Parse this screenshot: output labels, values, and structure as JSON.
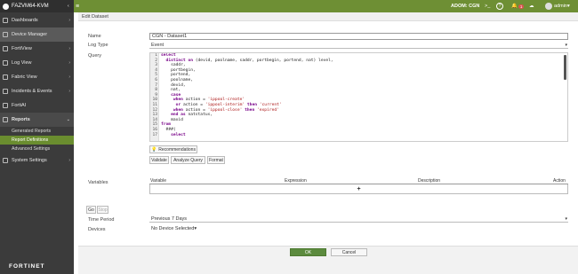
{
  "topbar": {
    "app_name": "FAZVM64-KVM",
    "adom_label": "ADOM: CGN",
    "notification_count": "1",
    "user_name": "admin"
  },
  "sidebar": {
    "items": [
      {
        "label": "Dashboards"
      },
      {
        "label": "Device Manager"
      },
      {
        "label": "FortiView"
      },
      {
        "label": "Log View"
      },
      {
        "label": "Fabric View"
      },
      {
        "label": "Incidents & Events"
      },
      {
        "label": "FortiAI"
      },
      {
        "label": "Reports"
      }
    ],
    "subitems": [
      {
        "label": "Generated Reports"
      },
      {
        "label": "Report Definitions"
      },
      {
        "label": "Advanced Settings"
      }
    ],
    "system_settings": "System Settings",
    "footer": "FORTINET"
  },
  "dialog": {
    "title": "Edit Dataset",
    "name_label": "Name",
    "name_value": "CGN - Dataset1",
    "log_type_label": "Log Type",
    "log_type_value": "Event",
    "query_label": "Query",
    "line_numbers": [
      "1",
      "2",
      "3",
      "4",
      "5",
      "6",
      "7",
      "8",
      "9",
      "10",
      "11",
      "12",
      "13",
      "14",
      "15",
      "16",
      "17"
    ],
    "recommendations_label": "Recommendations",
    "validate_label": "Validate",
    "analyze_label": "Analyze Query",
    "format_label": "Format",
    "variables_label": "Variables",
    "var_columns": {
      "variable": "Variable",
      "expression": "Expression",
      "description": "Description",
      "action": "Action"
    },
    "add_icon": "+",
    "go_label": "Go",
    "stop_label": "Stop",
    "time_period_label": "Time Period",
    "time_period_value": "Previous 7 Days",
    "devices_label": "Devices",
    "devices_value": "No Device Selected",
    "ok_label": "OK",
    "cancel_label": "Cancel"
  },
  "colors": {
    "accent": "#6e8f34",
    "sidebar": "#3b3b3b",
    "active_sub": "#6a8d2f"
  }
}
